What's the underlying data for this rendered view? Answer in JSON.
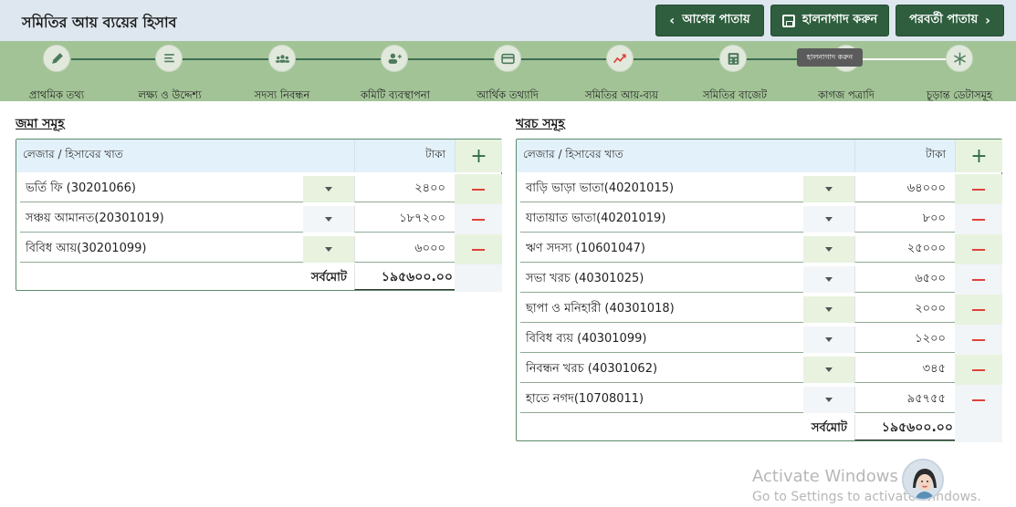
{
  "header": {
    "title": "সমিতির আয় ব্যয়ের হিসাব",
    "prev_label": "আগের পাতায়",
    "save_label": "হালনাগাদ করুন",
    "next_label": "পরবর্তী পাতায়"
  },
  "stepper": {
    "steps": [
      {
        "label": "প্রাথমিক তথ্য",
        "icon": "pencil-icon"
      },
      {
        "label": "লক্ষ্য ও উদ্দেশ্য",
        "icon": "document-lines-icon"
      },
      {
        "label": "সদস্য নিবন্ধন",
        "icon": "group-icon"
      },
      {
        "label": "কমিটি ব্যবস্থাপনা",
        "icon": "add-user-icon"
      },
      {
        "label": "আর্থিক তথ্যাদি",
        "icon": "card-icon"
      },
      {
        "label": "সমিতির আয়-ব্যয়",
        "icon": "trend-chart-icon"
      },
      {
        "label": "সমিতির বাজেট",
        "icon": "calculator-icon"
      },
      {
        "label": "কাগজ পত্রাদি",
        "icon": "document-icon"
      },
      {
        "label": "চূড়ান্ত ডেটাসমূহ",
        "icon": "snowflake-icon"
      }
    ],
    "active_index": 5,
    "tooltip": "হালনাগাদ করুন"
  },
  "income": {
    "title": "জমা সমূহ",
    "col_ledger": "লেজার / হিসাবের খাত",
    "col_amount": "টাকা",
    "rows": [
      {
        "ledger": "ভর্তি ফি (30201066)",
        "amount": "২৪০০"
      },
      {
        "ledger": "সঞ্চয় আমানত(20301019)",
        "amount": "১৮৭২০০"
      },
      {
        "ledger": "বিবিধ আয়(30201099)",
        "amount": "৬০০০"
      }
    ],
    "total_label": "সর্বমোট",
    "total_value": "১৯৫৬০০.০০"
  },
  "expense": {
    "title": "খরচ সমূহ",
    "col_ledger": "লেজার / হিসাবের খাত",
    "col_amount": "টাকা",
    "rows": [
      {
        "ledger": "বাড়ি ভাড়া ভাতা(40201015)",
        "amount": "৬৪০০০"
      },
      {
        "ledger": "যাতায়াত ভাতা(40201019)",
        "amount": "৮০০"
      },
      {
        "ledger": "ঋণ সদস্য (10601047)",
        "amount": "২৫০০০"
      },
      {
        "ledger": "সভা খরচ (40301025)",
        "amount": "৬৫০০"
      },
      {
        "ledger": "ছাপা ও মনিহারী (40301018)",
        "amount": "২০০০"
      },
      {
        "ledger": "বিবিধ ব্যয় (40301099)",
        "amount": "১২০০"
      },
      {
        "ledger": "নিবন্ধন খরচ (40301062)",
        "amount": "৩৪৫"
      },
      {
        "ledger": "হাতে নগদ(10708011)",
        "amount": "৯৫৭৫৫"
      }
    ],
    "total_label": "সর্বমোট",
    "total_value": "১৯৫৬০০.০০"
  },
  "watermark": {
    "line1": "Activate Windows",
    "line2": "Go to Settings to activate Windows."
  },
  "colors": {
    "primary": "#2e5e3d",
    "stepper_bg": "#a2c396",
    "header_bg": "#dee7ef",
    "remove_red": "#e0413a"
  }
}
